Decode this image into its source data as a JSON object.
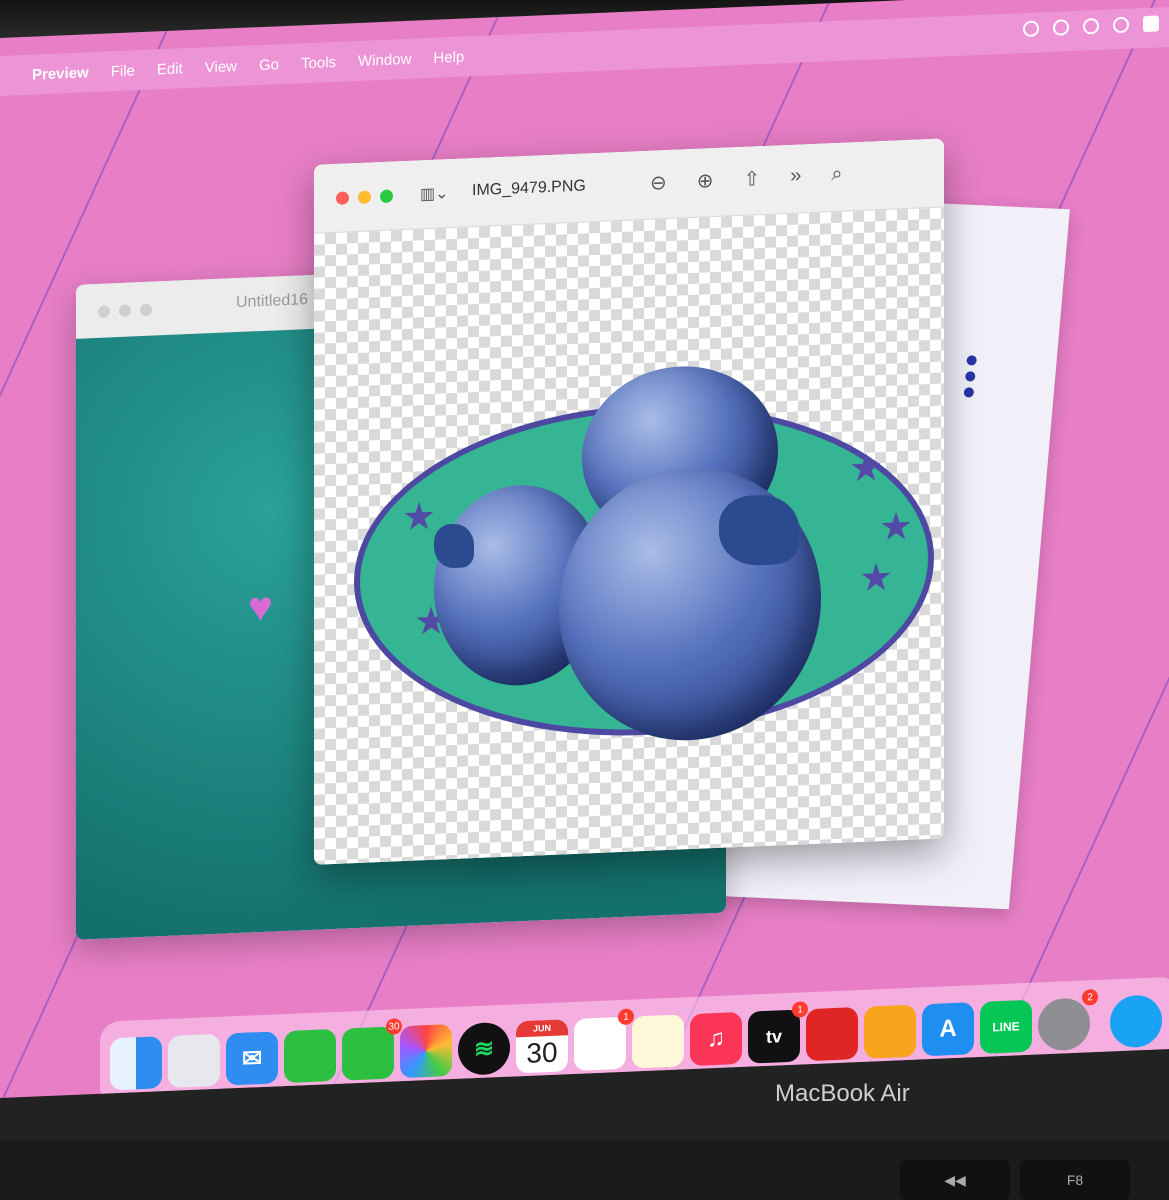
{
  "menubar": {
    "app": "Preview",
    "items": [
      "File",
      "Edit",
      "View",
      "Go",
      "Tools",
      "Window",
      "Help"
    ]
  },
  "back_window": {
    "title": "Untitled16"
  },
  "front_window": {
    "title": "IMG_9479.PNG"
  },
  "dock": {
    "messages_badge": "30",
    "calendar_month": "JUN",
    "calendar_day": "30",
    "reminders_badge": "1",
    "tv_badge": "1",
    "settings_badge": "2",
    "line_label": "LINE",
    "tv_label": "tv"
  },
  "laptop": {
    "brand": "MacBook Air"
  },
  "keyboard": {
    "key_fn": "F8"
  }
}
